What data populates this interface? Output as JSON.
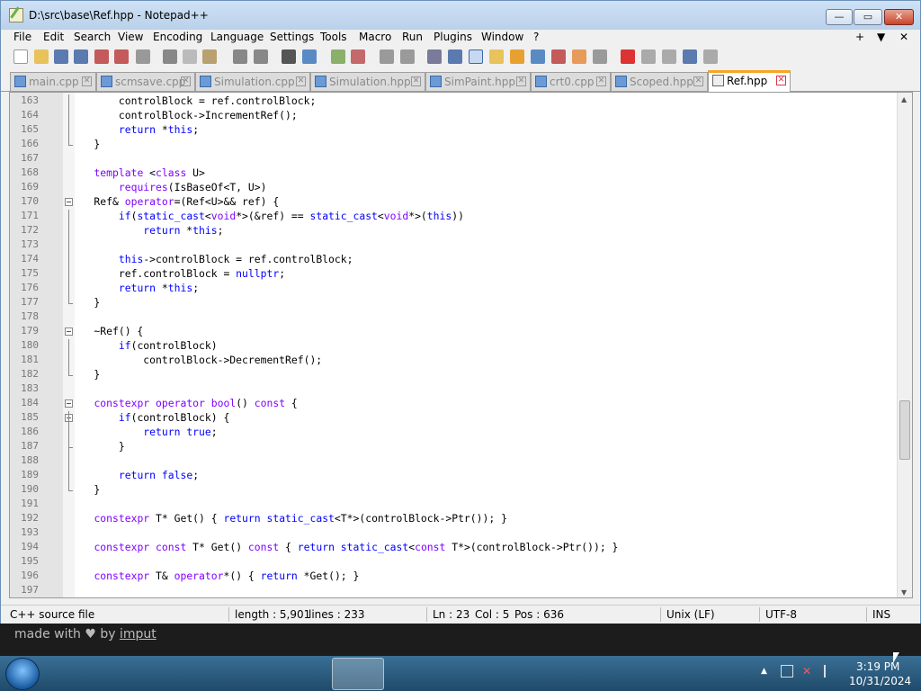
{
  "window": {
    "title": "D:\\src\\base\\Ref.hpp - Notepad++",
    "min_glyph": "—",
    "max_glyph": "▭",
    "close_glyph": "✕"
  },
  "menu": {
    "items": [
      "File",
      "Edit",
      "Search",
      "View",
      "Encoding",
      "Language",
      "Settings",
      "Tools",
      "Macro",
      "Run",
      "Plugins",
      "Window",
      "?"
    ],
    "right": [
      "+",
      "▼",
      "✕"
    ]
  },
  "tabs": [
    {
      "label": "main.cpp",
      "active": false
    },
    {
      "label": "scmsave.cpp",
      "active": false
    },
    {
      "label": "Simulation.cpp",
      "active": false
    },
    {
      "label": "Simulation.hpp",
      "active": false
    },
    {
      "label": "SimPaint.hpp",
      "active": false
    },
    {
      "label": "crt0.cpp",
      "active": false
    },
    {
      "label": "Scoped.hpp",
      "active": false
    },
    {
      "label": "Ref.hpp",
      "active": true
    }
  ],
  "editor": {
    "lines": [
      {
        "n": "163",
        "html": "        controlBlock = ref.controlBlock;"
      },
      {
        "n": "164",
        "html": "        controlBlock->IncrementRef();"
      },
      {
        "n": "165",
        "html": "        <span class=\"kw\">return</span> *<span class=\"kw\">this</span>;"
      },
      {
        "n": "166",
        "html": "    }"
      },
      {
        "n": "167",
        "html": ""
      },
      {
        "n": "168",
        "html": "    <span class=\"ty\">template</span> &lt;<span class=\"ty\">class</span> U&gt;"
      },
      {
        "n": "169",
        "html": "        <span class=\"ty\">requires</span>(IsBaseOf&lt;T, U&gt;)"
      },
      {
        "n": "170",
        "html": "    Ref&amp; <span class=\"ty\">operator</span>=(Ref&lt;U&gt;&amp;&amp; ref) {"
      },
      {
        "n": "171",
        "html": "        <span class=\"kw\">if</span>(<span class=\"kw\">static_cast</span>&lt;<span class=\"ty\">void</span>*&gt;(&amp;ref) == <span class=\"kw\">static_cast</span>&lt;<span class=\"ty\">void</span>*&gt;(<span class=\"kw\">this</span>))"
      },
      {
        "n": "172",
        "html": "            <span class=\"kw\">return</span> *<span class=\"kw\">this</span>;"
      },
      {
        "n": "173",
        "html": ""
      },
      {
        "n": "174",
        "html": "        <span class=\"kw\">this</span>->controlBlock = ref.controlBlock;"
      },
      {
        "n": "175",
        "html": "        ref.controlBlock = <span class=\"kw\">nullptr</span>;"
      },
      {
        "n": "176",
        "html": "        <span class=\"kw\">return</span> *<span class=\"kw\">this</span>;"
      },
      {
        "n": "177",
        "html": "    }"
      },
      {
        "n": "178",
        "html": ""
      },
      {
        "n": "179",
        "html": "    ~Ref() {"
      },
      {
        "n": "180",
        "html": "        <span class=\"kw\">if</span>(controlBlock)"
      },
      {
        "n": "181",
        "html": "            controlBlock->DecrementRef();"
      },
      {
        "n": "182",
        "html": "    }"
      },
      {
        "n": "183",
        "html": ""
      },
      {
        "n": "184",
        "html": "    <span class=\"ty\">constexpr</span> <span class=\"ty\">operator</span> <span class=\"ty\">bool</span>() <span class=\"ty\">const</span> {"
      },
      {
        "n": "185",
        "html": "        <span class=\"kw\">if</span>(controlBlock) {"
      },
      {
        "n": "186",
        "html": "            <span class=\"kw\">return</span> <span class=\"kw\">true</span>;"
      },
      {
        "n": "187",
        "html": "        }"
      },
      {
        "n": "188",
        "html": ""
      },
      {
        "n": "189",
        "html": "        <span class=\"kw\">return</span> <span class=\"kw\">false</span>;"
      },
      {
        "n": "190",
        "html": "    }"
      },
      {
        "n": "191",
        "html": ""
      },
      {
        "n": "192",
        "html": "    <span class=\"ty\">constexpr</span> T* Get() { <span class=\"kw\">return</span> <span class=\"kw\">static_cast</span>&lt;T*&gt;(controlBlock->Ptr()); }"
      },
      {
        "n": "193",
        "html": ""
      },
      {
        "n": "194",
        "html": "    <span class=\"ty\">constexpr</span> <span class=\"ty\">const</span> T* Get() <span class=\"ty\">const</span> { <span class=\"kw\">return</span> <span class=\"kw\">static_cast</span>&lt;<span class=\"ty\">const</span> T*&gt;(controlBlock->Ptr()); }"
      },
      {
        "n": "195",
        "html": ""
      },
      {
        "n": "196",
        "html": "    <span class=\"ty\">constexpr</span> T&amp; <span class=\"ty\">operator</span>*() { <span class=\"kw\">return</span> *Get(); }"
      },
      {
        "n": "197",
        "html": ""
      }
    ],
    "keyword_color": "#0000ff",
    "type_color": "#8000ff"
  },
  "status": {
    "file_type": "C++ source file",
    "length": "length : 5,901",
    "lines": "lines : 233",
    "ln": "Ln : 23",
    "col": "Col : 5",
    "pos": "Pos : 636",
    "eol": "Unix (LF)",
    "encoding": "UTF-8",
    "mode": "INS"
  },
  "banner": {
    "made_with": "made with ♥ by ",
    "author": "imput"
  },
  "taskbar": {
    "apps": [
      {
        "name": "internet-explorer-icon",
        "color": "#2b8fd8"
      },
      {
        "name": "firefox-icon",
        "color": "#e8672a"
      },
      {
        "name": "file-explorer-icon",
        "color": "#e6c35a"
      },
      {
        "name": "media-player-icon",
        "color": "#f0a23a"
      },
      {
        "name": "wmp-icon",
        "color": "#3aa66b"
      },
      {
        "name": "notepadpp-icon",
        "color": "#8fc46a"
      }
    ],
    "clock_time": "3:19 PM",
    "clock_date": "10/31/2024"
  }
}
